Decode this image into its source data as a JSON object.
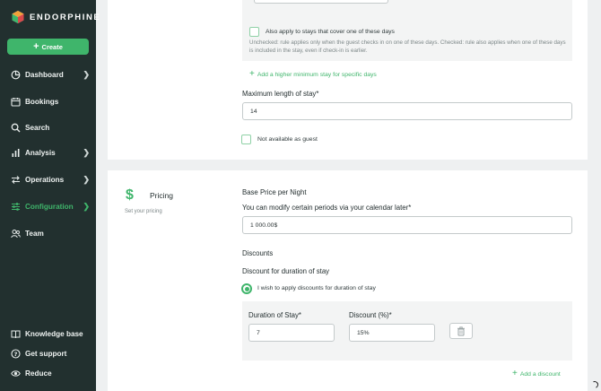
{
  "brand": {
    "name": "ENDORPHINE"
  },
  "sidebar": {
    "create_label": "Create",
    "items": [
      {
        "label": "Dashboard",
        "icon": "dashboard-icon",
        "has_chevron": true
      },
      {
        "label": "Bookings",
        "icon": "calendar-icon",
        "has_chevron": false
      },
      {
        "label": "Search",
        "icon": "search-icon",
        "has_chevron": false
      },
      {
        "label": "Analysis",
        "icon": "bar-chart-icon",
        "has_chevron": true
      },
      {
        "label": "Operations",
        "icon": "arrows-icon",
        "has_chevron": true
      },
      {
        "label": "Configuration",
        "icon": "sliders-icon",
        "has_chevron": true,
        "active": true
      },
      {
        "label": "Team",
        "icon": "team-icon",
        "has_chevron": false
      }
    ],
    "bottom_items": [
      {
        "label": "Knowledge base",
        "icon": "book-icon"
      },
      {
        "label": "Get support",
        "icon": "help-icon"
      },
      {
        "label": "Reduce",
        "icon": "eye-icon"
      }
    ]
  },
  "stay": {
    "also_apply_label": "Also apply to stays that cover one of these days",
    "also_apply_help": "Unchecked: rule applies only when the guest checks in on one of these days. Checked: rule also applies when one of these days is included in the stay, even if check-in is earlier.",
    "add_min_stay_link": "Add a higher minimum stay for specific days",
    "max_length_label": "Maximum length of stay*",
    "max_length_value": "14",
    "not_available_label": "Not available as guest"
  },
  "pricing": {
    "title": "Pricing",
    "subtitle": "Set your pricing",
    "base_price_label": "Base Price per Night",
    "modify_label": "You can modify certain periods via your calendar later*",
    "base_price_value": "1 000.00$",
    "discounts_title": "Discounts",
    "duration_discount_title": "Discount for duration of stay",
    "apply_discounts_label": "I wish to apply discounts for duration of stay",
    "duration_label": "Duration of Stay*",
    "discount_label": "Discount (%)*",
    "duration_value": "7",
    "discount_value": "15%",
    "add_discount_link": "Add a discount"
  },
  "colors": {
    "accent": "#3fb56b",
    "sidebar_bg": "#22302f"
  }
}
